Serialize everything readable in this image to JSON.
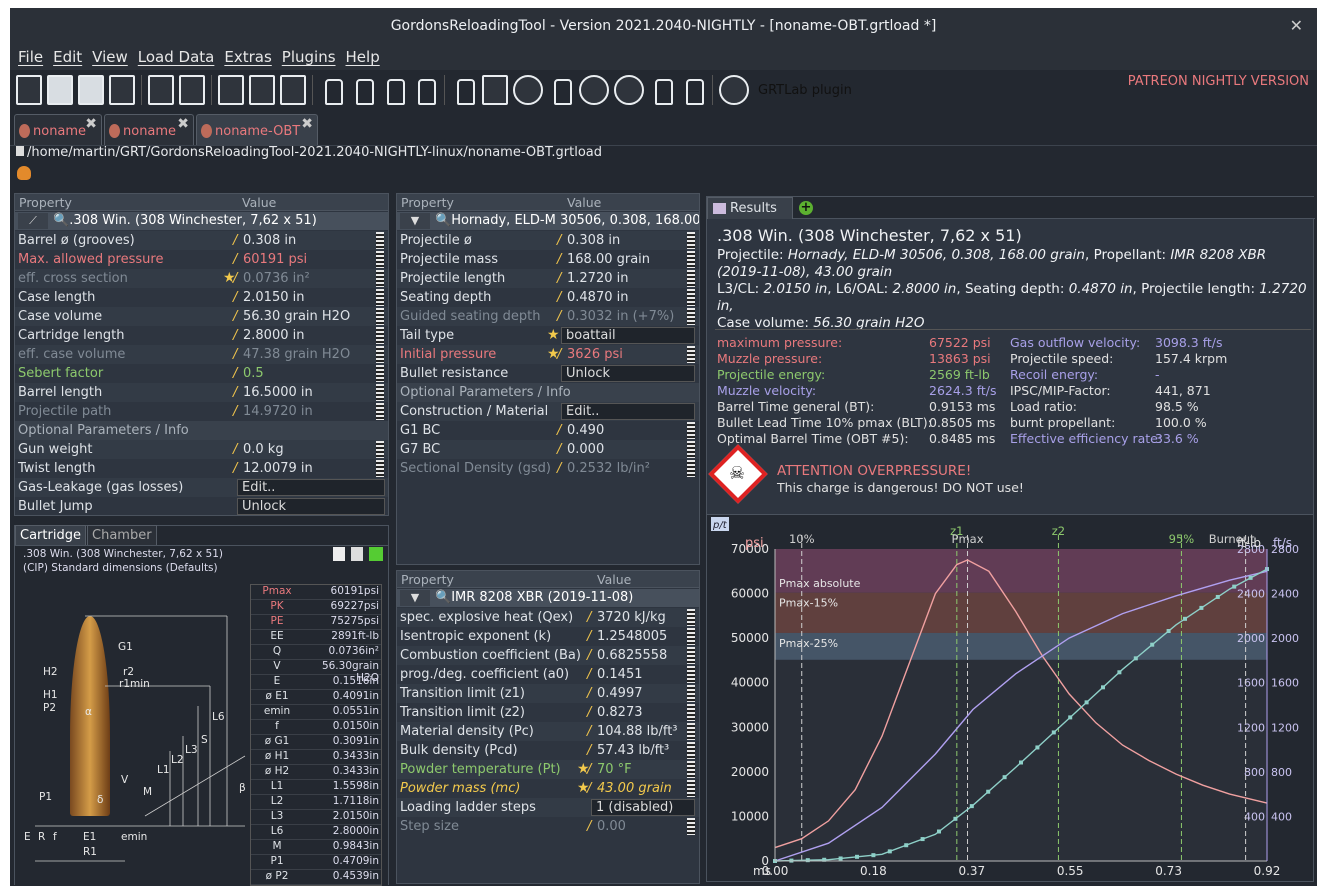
{
  "title": "GordonsReloadingTool - Version 2021.2040-NIGHTLY - [noname-OBT.grtload *]",
  "menu": [
    "File",
    "Edit",
    "View",
    "Load Data",
    "Extras",
    "Plugins",
    "Help"
  ],
  "toolbar": {
    "plugin_label": "GRTLab plugin",
    "patreon": "PATREON NIGHTLY VERSION"
  },
  "doc_tabs": [
    "noname",
    "noname",
    "noname-OBT"
  ],
  "path": "/home/martin/GRT/GordonsReloadingTool-2021.2040-NIGHTLY-linux/noname-OBT.grtload",
  "cartridge_panel": {
    "header": {
      "property": "Property",
      "value": "Value"
    },
    "selector": ".308 Win. (308 Winchester, 7,62 x 51)",
    "rows": [
      {
        "k": "Barrel ø (grooves)",
        "v": "0.308 in",
        "cls": ""
      },
      {
        "k": "Max. allowed pressure",
        "v": "60191 psi",
        "cls": "red"
      },
      {
        "k": "eff. cross section",
        "v": "0.0736 in²",
        "cls": "dim",
        "star": true
      },
      {
        "k": "Case length",
        "v": "2.0150 in",
        "cls": ""
      },
      {
        "k": "Case volume",
        "v": "56.30 grain H2O",
        "cls": ""
      },
      {
        "k": "Cartridge length",
        "v": "2.8000 in",
        "cls": ""
      },
      {
        "k": "eff. case volume",
        "v": "47.38 grain H2O",
        "cls": "dim"
      },
      {
        "k": "Sebert factor",
        "v": "0.5",
        "cls": "grn"
      },
      {
        "k": "Barrel length",
        "v": "16.5000 in",
        "cls": ""
      },
      {
        "k": "Projectile path",
        "v": "14.9720 in",
        "cls": "dim"
      }
    ],
    "optional_header": "Optional Parameters / Info",
    "optional_rows": [
      {
        "k": "Gun weight",
        "v": "0.0 kg"
      },
      {
        "k": "Twist length",
        "v": "12.0079 in"
      },
      {
        "k": "Gas-Leakage (gas losses)",
        "btn": "Edit.."
      },
      {
        "k": "Bullet Jump",
        "btn": "Unlock"
      }
    ]
  },
  "cart_tabs": [
    "Cartridge",
    "Chamber"
  ],
  "cart_diagram": {
    "title": ".308 Win. (308 Winchester, 7,62 x 51)",
    "subtitle": "(CIP) Standard dimensions (Defaults)",
    "table": [
      {
        "n": "Pmax",
        "v": "60191psi",
        "red": true
      },
      {
        "n": "PK",
        "v": "69227psi",
        "red": true
      },
      {
        "n": "PE",
        "v": "75275psi",
        "red": true
      },
      {
        "n": "EE",
        "v": "2891ft-lb"
      },
      {
        "n": "Q",
        "v": "0.0736in²"
      },
      {
        "n": "V",
        "v": "56.30grain H2O"
      },
      {
        "n": "E",
        "v": "0.1516in"
      },
      {
        "n": "ø E1",
        "v": "0.4091in"
      },
      {
        "n": "emin",
        "v": "0.0551in"
      },
      {
        "n": "f",
        "v": "0.0150in"
      },
      {
        "n": "ø G1",
        "v": "0.3091in"
      },
      {
        "n": "ø H1",
        "v": "0.3433in"
      },
      {
        "n": "ø H2",
        "v": "0.3433in"
      },
      {
        "n": "L1",
        "v": "1.5598in"
      },
      {
        "n": "L2",
        "v": "1.7118in"
      },
      {
        "n": "L3",
        "v": "2.0150in"
      },
      {
        "n": "L6",
        "v": "2.8000in"
      },
      {
        "n": "M",
        "v": "0.9843in"
      },
      {
        "n": "P1",
        "v": "0.4709in"
      },
      {
        "n": "ø P2",
        "v": "0.4539in"
      }
    ],
    "labels": [
      "G1",
      "H2",
      "r2",
      "r1min",
      "H1",
      "P2",
      "α",
      "L6",
      "S",
      "L3",
      "L2",
      "L1",
      "V",
      "M",
      "β",
      "P1",
      "δ",
      "E",
      "R",
      "f",
      "E1",
      "R1",
      "emin"
    ]
  },
  "projectile_panel": {
    "header": {
      "property": "Property",
      "value": "Value"
    },
    "selector": "Hornady, ELD-M 30506, 0.308, 168.00 grain",
    "rows": [
      {
        "k": "Projectile ø",
        "v": "0.308 in"
      },
      {
        "k": "Projectile mass",
        "v": "168.00 grain"
      },
      {
        "k": "Projectile length",
        "v": "1.2720 in"
      },
      {
        "k": "Seating depth",
        "v": "0.4870 in"
      },
      {
        "k": "Guided seating depth",
        "v": "0.3032 in (+7%)",
        "cls": "dim"
      },
      {
        "k": "Tail type",
        "btn": "boattail",
        "star": true
      },
      {
        "k": "Initial pressure",
        "v": "3626 psi",
        "cls": "red",
        "star": true
      },
      {
        "k": "Bullet resistance",
        "btn": "Unlock"
      }
    ],
    "optional_header": "Optional Parameters / Info",
    "optional_rows": [
      {
        "k": "Construction / Material",
        "btn": "Edit.."
      },
      {
        "k": "G1 BC",
        "v": "0.490"
      },
      {
        "k": "G7 BC",
        "v": "0.000"
      },
      {
        "k": "Sectional Density (gsd)",
        "v": "0.2532 lb/in²",
        "cls": "dim"
      }
    ]
  },
  "powder_panel": {
    "header": {
      "property": "Property",
      "value": "Value"
    },
    "selector": "IMR 8208 XBR (2019-11-08)",
    "rows": [
      {
        "k": "spec. explosive heat (Qex)",
        "v": "3720 kJ/kg"
      },
      {
        "k": "Isentropic exponent (k)",
        "v": "1.2548005"
      },
      {
        "k": "Combustion coefficient (Ba)",
        "v": "0.6825558"
      },
      {
        "k": "prog./deg. coefficient (a0)",
        "v": "0.1451"
      },
      {
        "k": "Transition limit (z1)",
        "v": "0.4997"
      },
      {
        "k": "Transition limit (z2)",
        "v": "0.8273"
      },
      {
        "k": "Material density (Pc)",
        "v": "104.88 lb/ft³"
      },
      {
        "k": "Bulk density (Pcd)",
        "v": "57.43 lb/ft³"
      },
      {
        "k": "Powder temperature (Pt)",
        "v": "70 °F",
        "cls": "grn",
        "star": true
      },
      {
        "k": "Powder mass (mc)",
        "v": "43.00 grain",
        "cls": "ylw ital",
        "star": true
      },
      {
        "k": "Loading ladder steps",
        "btn": "1 (disabled)"
      },
      {
        "k": "Step size",
        "v": "0.00",
        "cls": "dim"
      }
    ]
  },
  "results": {
    "tab": "Results",
    "heading": ".308 Win. (308 Winchester, 7,62 x 51)",
    "line_projectile_label": "Projectile: ",
    "line_projectile": "Hornady, ELD-M 30506, 0.308, 168.00 grain",
    "line_propellant_label": ", Propellant: ",
    "line_propellant": "IMR 8208 XBR (2019-11-08), 43.00 grain",
    "line_dims_1_label": "L3/CL: ",
    "line_dims_1": "2.0150 in",
    "line_dims_2_label": ", L6/OAL: ",
    "line_dims_2": "2.8000 in",
    "line_dims_3_label": ", Seating depth: ",
    "line_dims_3": "0.4870 in",
    "line_dims_4_label": ", Projectile length: ",
    "line_dims_4": "1.2720 in,",
    "line_case_label": "Case volume: ",
    "line_case": "56.30 grain H2O",
    "left": [
      {
        "k": "maximum pressure:",
        "v": "67522 psi",
        "c": "red"
      },
      {
        "k": "Muzzle pressure:",
        "v": "13863 psi",
        "c": "red"
      },
      {
        "k": "Projectile energy:",
        "v": "2569 ft-lb",
        "c": "grn"
      },
      {
        "k": "Muzzle velocity:",
        "v": "2624.3 ft/s",
        "c": "violet"
      },
      {
        "k": "Barrel Time general (BT):",
        "v": "0.9153 ms",
        "c": ""
      },
      {
        "k": "Bullet Lead Time 10% pmax (BLT):",
        "v": "0.8505 ms",
        "c": ""
      },
      {
        "k": "Optimal Barrel Time (OBT #5):",
        "v": "0.8485 ms",
        "c": ""
      }
    ],
    "right": [
      {
        "k": "Gas outflow velocity:",
        "v": "3098.3 ft/s",
        "c": "violet"
      },
      {
        "k": "Projectile speed:",
        "v": "157.4 krpm",
        "c": ""
      },
      {
        "k": "Recoil energy:",
        "v": "-",
        "c": "dimk"
      },
      {
        "k": "IPSC/MIP-Factor:",
        "v": "441, 871",
        "c": ""
      },
      {
        "k": "Load ratio:",
        "v": "98.5 %",
        "c": ""
      },
      {
        "k": "burnt propellant:",
        "v": "100.0 %",
        "c": ""
      },
      {
        "k": "Effective efficiency rate:",
        "v": "33.6 %",
        "c": "violet"
      }
    ],
    "warn_title": "ATTENTION OVERPRESSURE!",
    "warn_text": "This charge is dangerous! DO NOT use!"
  },
  "chart_data": {
    "type": "line",
    "corner_label": "p/t",
    "left_unit": "psi",
    "right_unit_1": "ft-lb",
    "right_unit_2": "ft/s",
    "x_unit": "ms",
    "x_ticks": [
      "0.00",
      "0.18",
      "0.37",
      "0.55",
      "0.73",
      "0.92"
    ],
    "xlim": [
      0,
      0.92
    ],
    "ylim": [
      0,
      70000
    ],
    "y_ticks": [
      "0",
      "10000",
      "20000",
      "30000",
      "40000",
      "50000",
      "60000",
      "70000"
    ],
    "right_ticks": [
      "400",
      "800",
      "1200",
      "1600",
      "2000",
      "2400",
      "2800"
    ],
    "right_ticks_b": [
      "400",
      "800",
      "1200",
      "1600",
      "2000",
      "2400",
      "2800"
    ],
    "markers": [
      {
        "label": "10%",
        "x": 0.05,
        "color": "#d0d0d0"
      },
      {
        "label": "z1",
        "x": 0.34,
        "color": "#8dc96d"
      },
      {
        "label": "Pmax",
        "x": 0.36,
        "color": "#d0d0d0"
      },
      {
        "label": "z2",
        "x": 0.53,
        "color": "#8dc96d"
      },
      {
        "label": "95%",
        "x": 0.76,
        "color": "#8dc96d"
      },
      {
        "label": "Burnout",
        "x": 0.88,
        "color": "#d0d0d0"
      }
    ],
    "bands": [
      {
        "label": "Pmax absolute",
        "y0": 60191,
        "y1": 70000,
        "color": "#6b3e5a"
      },
      {
        "label": "Pmax-15%",
        "y0": 51162,
        "y1": 60191,
        "color": "#6a4340"
      },
      {
        "label": "Pmax-25%",
        "y0": 45143,
        "y1": 51162,
        "color": "#4a5c70"
      }
    ],
    "series": [
      {
        "name": "pressure",
        "color": "#f0a0a0",
        "x": [
          0,
          0.05,
          0.1,
          0.15,
          0.2,
          0.25,
          0.3,
          0.34,
          0.36,
          0.4,
          0.45,
          0.5,
          0.55,
          0.6,
          0.65,
          0.7,
          0.75,
          0.8,
          0.85,
          0.92
        ],
        "y": [
          3000,
          5000,
          9000,
          16000,
          28000,
          44000,
          60000,
          66500,
          67522,
          65000,
          56000,
          46000,
          37500,
          31000,
          26000,
          22500,
          19500,
          17000,
          15000,
          13000
        ]
      },
      {
        "name": "velocity",
        "color": "#b0a0f0",
        "x": [
          0,
          0.1,
          0.2,
          0.3,
          0.37,
          0.45,
          0.55,
          0.65,
          0.75,
          0.85,
          0.92
        ],
        "y": [
          0,
          4000,
          12000,
          24000,
          34000,
          42000,
          50000,
          55500,
          59500,
          63000,
          65000
        ]
      },
      {
        "name": "energy",
        "color": "#8ed0c8",
        "x": [
          0,
          0.1,
          0.2,
          0.3,
          0.37,
          0.45,
          0.55,
          0.65,
          0.75,
          0.85,
          0.92
        ],
        "y": [
          0,
          300,
          1500,
          6000,
          12500,
          21000,
          32000,
          43000,
          53000,
          61000,
          65500
        ]
      }
    ]
  }
}
